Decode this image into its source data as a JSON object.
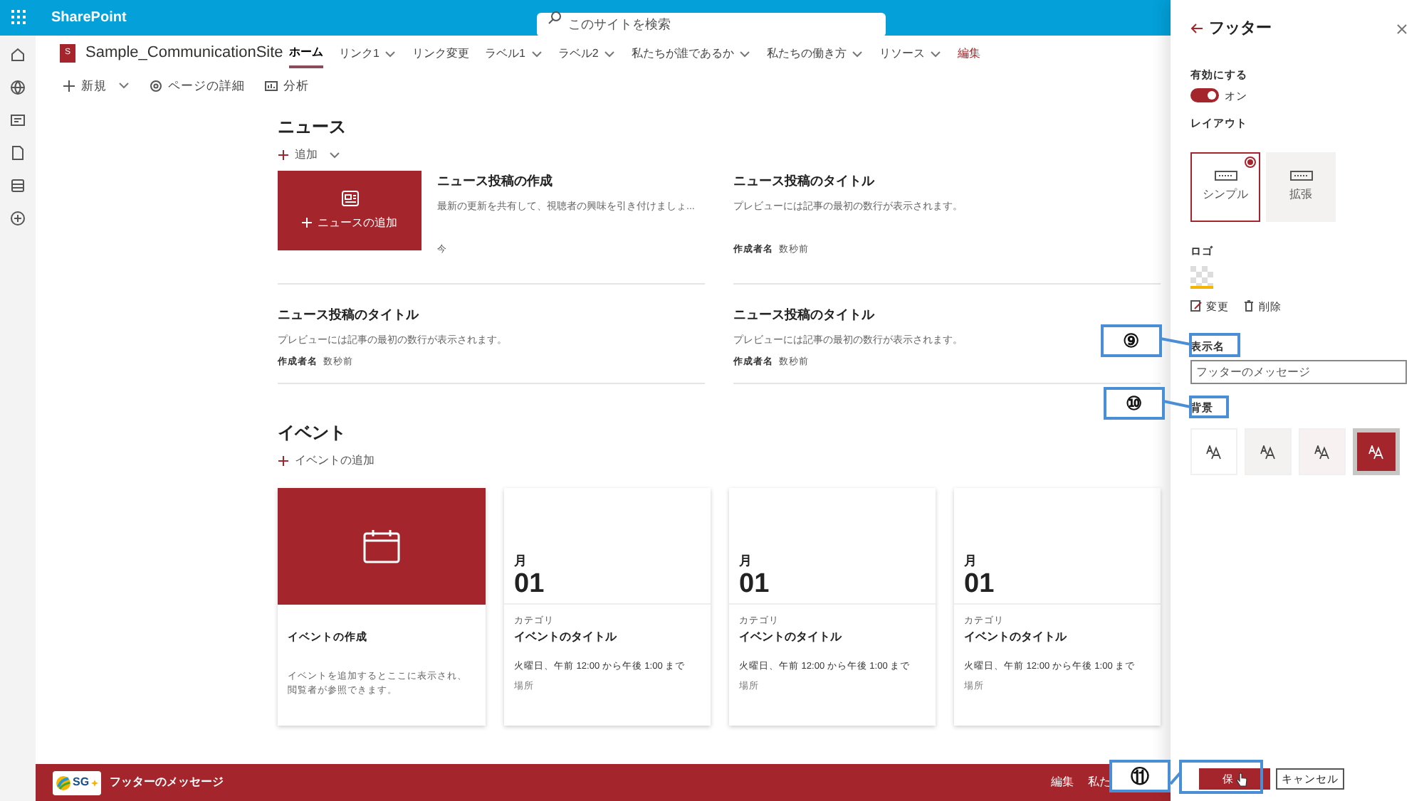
{
  "top_bar": {
    "app": "SharePoint",
    "search_placeholder": "このサイトを検索"
  },
  "site": {
    "logo_letter": "S",
    "name": "Sample_CommunicationSite"
  },
  "nav": [
    {
      "label": "ホーム",
      "kind": "link",
      "dropdown": false,
      "selected": true
    },
    {
      "label": "リンク1",
      "kind": "link",
      "dropdown": true,
      "selected": false
    },
    {
      "label": "リンク変更",
      "kind": "link",
      "dropdown": false,
      "selected": false
    },
    {
      "label": "ラベル1",
      "kind": "link",
      "dropdown": true,
      "selected": false
    },
    {
      "label": "ラベル2",
      "kind": "link",
      "dropdown": true,
      "selected": false
    },
    {
      "label": "私たちが誰であるか",
      "kind": "link",
      "dropdown": true,
      "selected": false
    },
    {
      "label": "私たちの働き方",
      "kind": "link",
      "dropdown": true,
      "selected": false
    },
    {
      "label": "リソース",
      "kind": "link",
      "dropdown": true,
      "selected": false
    },
    {
      "label": "編集",
      "kind": "edit",
      "dropdown": false,
      "selected": false
    }
  ],
  "commands": [
    {
      "label": "新規",
      "kind": "new",
      "dropdown": true
    },
    {
      "label": "ページの詳細",
      "kind": "details",
      "dropdown": false
    },
    {
      "label": "分析",
      "kind": "analytics",
      "dropdown": false
    }
  ],
  "news": {
    "heading": "ニュース",
    "add": "追加",
    "create_label": "ニュースの追加",
    "items": [
      {
        "title": "ニュース投稿の作成",
        "text": "最新の更新を共有して、視聴者の興味を引き付けましょ...",
        "time": "今"
      },
      {
        "title": "ニュース投稿のタイトル",
        "text": "プレビューには記事の最初の数行が表示されます。",
        "author": "作成者名",
        "time": "数秒前"
      },
      {
        "title": "ニュース投稿のタイトル",
        "text": "プレビューには記事の最初の数行が表示されます。",
        "author": "作成者名",
        "time": "数秒前"
      },
      {
        "title": "ニュース投稿のタイトル",
        "text": "プレビューには記事の最初の数行が表示されます。",
        "author": "作成者名",
        "time": "数秒前"
      }
    ]
  },
  "events": {
    "heading": "イベント",
    "add": "イベントの追加",
    "create": {
      "title": "イベントの作成",
      "text": "イベントを追加するとここに表示され、閲覧者が参照できます。"
    },
    "items": [
      {
        "month": "月",
        "day": "01",
        "category": "カテゴリ",
        "title": "イベントのタイトル",
        "time": "火曜日、午前 12:00 から午後 1:00 まで",
        "location": "場所"
      },
      {
        "month": "月",
        "day": "01",
        "category": "カテゴリ",
        "title": "イベントのタイトル",
        "time": "火曜日、午前 12:00 から午後 1:00 まで",
        "location": "場所"
      },
      {
        "month": "月",
        "day": "01",
        "category": "カテゴリ",
        "title": "イベントのタイトル",
        "time": "火曜日、午前 12:00 から午後 1:00 まで",
        "location": "場所"
      }
    ]
  },
  "footer": {
    "logo_text": "SG",
    "message": "フッターのメッセージ",
    "links": [
      "編集",
      "私た"
    ]
  },
  "panel": {
    "title": "フッター",
    "enable": {
      "label": "有効にする",
      "on": true,
      "state_text": "オン"
    },
    "layout_label": "レイアウト",
    "layouts": [
      {
        "label": "シンプル",
        "selected": true
      },
      {
        "label": "拡張",
        "selected": false
      }
    ],
    "logo_label": "ロゴ",
    "change": "変更",
    "delete": "削除",
    "display_name_label": "表示名",
    "display_name": "フッターのメッセージ",
    "background_label": "背景",
    "backgrounds": [
      {
        "color": "#ffffff",
        "selected": false
      },
      {
        "color": "#f3f2f1",
        "selected": false
      },
      {
        "color": "#f8f1f1",
        "selected": false
      },
      {
        "color": "#a4262c",
        "selected": true
      }
    ],
    "save": "保",
    "cancel": "キャンセル"
  },
  "callouts": [
    {
      "label": "⑨"
    },
    {
      "label": "⑩"
    },
    {
      "label": "⑪"
    }
  ]
}
